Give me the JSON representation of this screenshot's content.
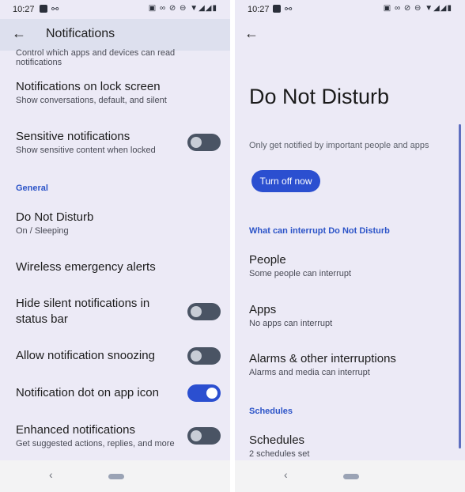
{
  "left": {
    "status": {
      "time": "10:27"
    },
    "appbar": {
      "back_icon": "arrow-left-icon",
      "title": "Notifications"
    },
    "partial_text": "Control which apps and devices can read notifications",
    "items": [
      {
        "title": "Notifications on lock screen",
        "subtitle": "Show conversations, default, and silent"
      },
      {
        "title": "Sensitive notifications",
        "subtitle": "Show sensitive content when locked",
        "toggle": false
      },
      {
        "title": "Do Not Disturb",
        "subtitle": "On / Sleeping"
      },
      {
        "title": "Wireless emergency alerts"
      },
      {
        "title": "Hide silent notifications in status bar",
        "toggle": false
      },
      {
        "title": "Allow notification snoozing",
        "toggle": false
      },
      {
        "title": "Notification dot on app icon",
        "toggle": true
      },
      {
        "title": "Enhanced notifications",
        "subtitle": "Get suggested actions, replies, and more",
        "toggle": false
      }
    ],
    "section_general": "General"
  },
  "right": {
    "status": {
      "time": "10:27"
    },
    "appbar": {
      "back_icon": "arrow-left-icon"
    },
    "title": "Do Not Disturb",
    "description": "Only get notified by important people and apps",
    "turn_off_label": "Turn off now",
    "section_interrupt": "What can interrupt Do Not Disturb",
    "items": [
      {
        "title": "People",
        "subtitle": "Some people can interrupt"
      },
      {
        "title": "Apps",
        "subtitle": "No apps can interrupt"
      },
      {
        "title": "Alarms & other interruptions",
        "subtitle": "Alarms and media can interrupt"
      }
    ],
    "section_schedules": "Schedules",
    "schedules": {
      "title": "Schedules",
      "subtitle": "2 schedules set"
    }
  },
  "colors": {
    "accent": "#2b4fd0",
    "background": "#eceaf6",
    "toggle_off": "#4a5464"
  }
}
